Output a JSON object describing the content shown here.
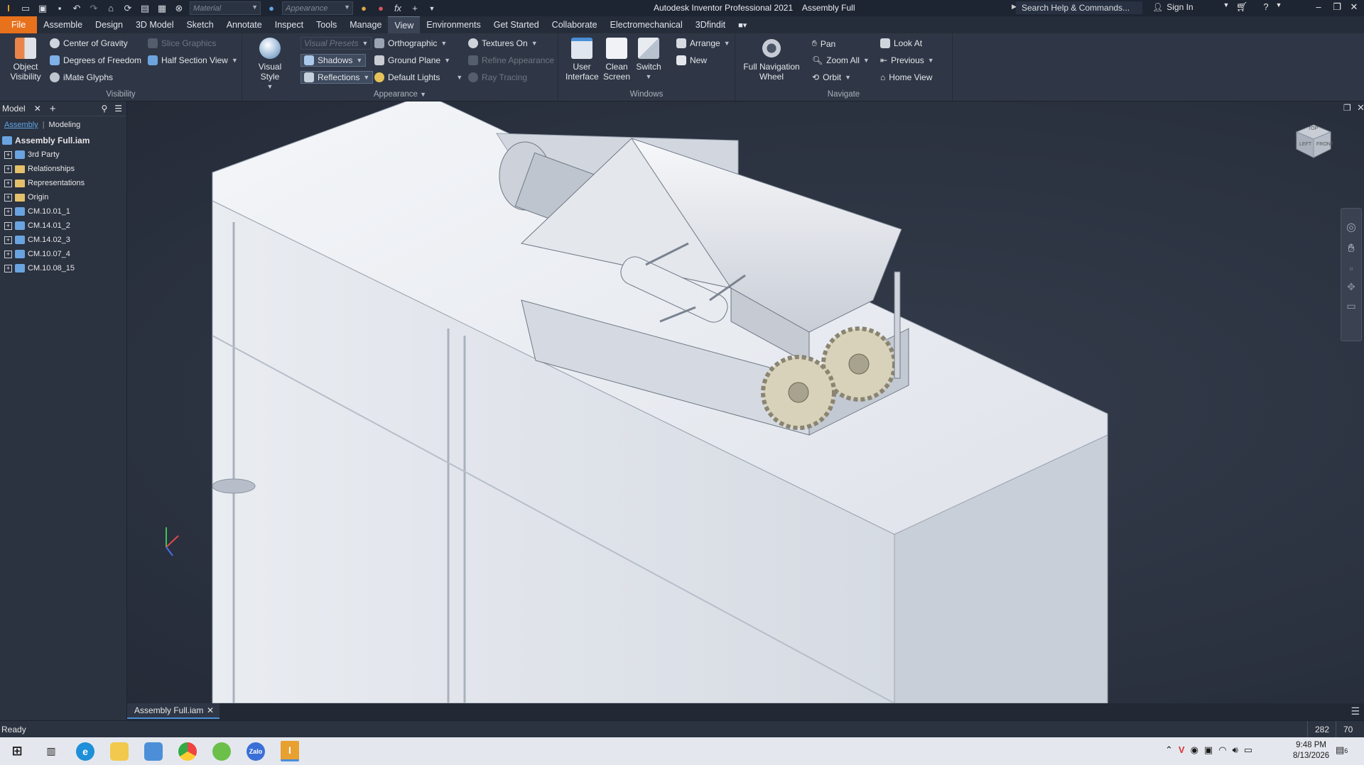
{
  "titlebar": {
    "material_placeholder": "Material",
    "appearance_placeholder": "Appearance",
    "app_title": "Autodesk Inventor Professional 2021",
    "doc_title": "Assembly Full",
    "search_placeholder": "Search Help & Commands...",
    "sign_in": "Sign In",
    "fx_label": "fx"
  },
  "menu_tabs": [
    "File",
    "Assemble",
    "Design",
    "3D Model",
    "Sketch",
    "Annotate",
    "Inspect",
    "Tools",
    "Manage",
    "View",
    "Environments",
    "Get Started",
    "Collaborate",
    "Electromechanical",
    "3Dfindit"
  ],
  "active_tab": "View",
  "ribbon": {
    "visibility": {
      "title": "Visibility",
      "object_visibility": "Object Visibility",
      "center_of_gravity": "Center of Gravity",
      "degrees_of_freedom": "Degrees of Freedom",
      "imate_glyphs": "iMate Glyphs",
      "slice_graphics": "Slice Graphics",
      "half_section_view": "Half Section View"
    },
    "appearance": {
      "title": "Appearance",
      "visual_style": "Visual Style",
      "visual_presets": "Visual Presets",
      "shadows": "Shadows",
      "reflections": "Reflections",
      "orthographic": "Orthographic",
      "ground_plane": "Ground Plane",
      "default_lights": "Default Lights",
      "textures_on": "Textures On",
      "refine_appearance": "Refine Appearance",
      "ray_tracing": "Ray Tracing"
    },
    "windows": {
      "title": "Windows",
      "user_interface": "User Interface",
      "clean_screen": "Clean Screen",
      "switch": "Switch",
      "arrange": "Arrange",
      "new": "New"
    },
    "navigate": {
      "title": "Navigate",
      "full_navigation_wheel": "Full Navigation Wheel",
      "pan": "Pan",
      "zoom_all": "Zoom All",
      "orbit": "Orbit",
      "look_at": "Look At",
      "previous": "Previous",
      "home_view": "Home View"
    }
  },
  "browser": {
    "tab": "Model",
    "subtab_active": "Assembly",
    "subtab_other": "Modeling",
    "root": "Assembly Full.iam",
    "items": [
      "3rd Party",
      "Relationships",
      "Representations",
      "Origin",
      "CM.10.01_1",
      "CM.14.01_2",
      "CM.14.02_3",
      "CM.10.07_4",
      "CM.10.08_15"
    ]
  },
  "viewcube": {
    "top": "TOP",
    "left": "LEFT",
    "front": "FRONT"
  },
  "document_tab": "Assembly Full.iam",
  "status": {
    "text": "Ready",
    "num1": "282",
    "num2": "70"
  },
  "taskbar": {
    "time": "9:48 PM",
    "date": "8/13/2026",
    "notifications": "6"
  },
  "colors": {
    "accent_file_tab": "#e8711c",
    "ribbon_bg": "#2f3746",
    "viewport_bg": "#2b3240"
  }
}
